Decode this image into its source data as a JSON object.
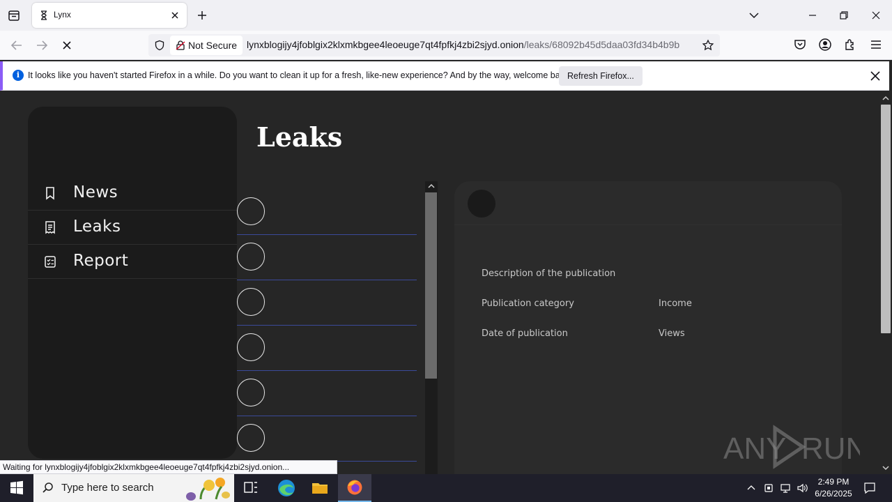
{
  "browser": {
    "tab_title": "Lynx",
    "security_label": "Not Secure",
    "url_host": "lynxblogijy4jfoblgix2klxmkbgee4leoeuge7qt4fpfkj4zbi2sjyd.onion",
    "url_path": "/leaks/68092b45d5daa03fd34b4b9b",
    "status_text": "Waiting for lynxblogijy4jfoblgix2klxmkbgee4leoeuge7qt4fpfkj4zbi2sjyd.onion..."
  },
  "notice": {
    "message": "It looks like you haven't started Firefox in a while. Do you want to clean it up for a fresh, like-new experience? And by the way, welcome back!",
    "refresh_label": "Refresh Firefox..."
  },
  "sidebar": {
    "items": [
      {
        "label": "News",
        "icon": "bookmark-icon"
      },
      {
        "label": "Leaks",
        "icon": "receipt-icon"
      },
      {
        "label": "Report",
        "icon": "checklist-icon"
      }
    ]
  },
  "main": {
    "title": "Leaks",
    "detail": {
      "description_label": "Description of the publication",
      "category_label": "Publication category",
      "income_label": "Income",
      "date_label": "Date of publication",
      "views_label": "Views"
    }
  },
  "watermark": "ANY RUN",
  "taskbar": {
    "search_placeholder": "Type here to search",
    "time": "2:49 PM",
    "date": "6/26/2025"
  },
  "colors": {
    "page_bg": "#262626",
    "sidebar_bg": "#1b1b1b",
    "row_divider": "#3b4a9a",
    "notice_accent": "#8b5cf6"
  }
}
